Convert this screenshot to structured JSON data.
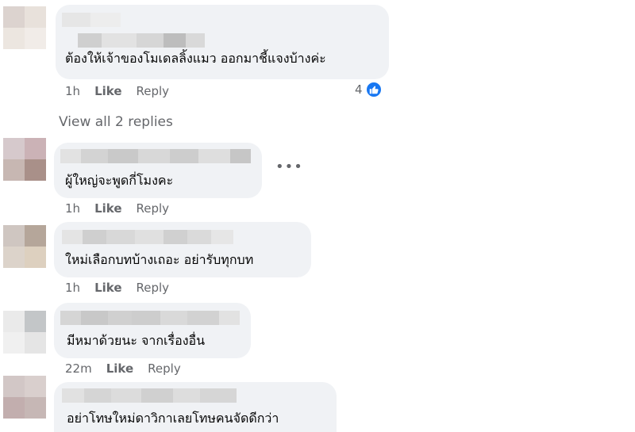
{
  "colors": {
    "bubble": "#f0f2f5",
    "meta": "#65676b",
    "like_badge": "#1877f2"
  },
  "comments": [
    {
      "text": "ต้องให้เจ้าของโมเดลลิ้งแมว ออกมาชี้แจงบ้างค่ะ",
      "time": "1h",
      "like": "Like",
      "reply": "Reply",
      "reaction_count": "4"
    },
    {
      "text": "ผู้ใหญ่จะพูดกี่โมงคะ",
      "time": "1h",
      "like": "Like",
      "reply": "Reply"
    },
    {
      "text": "ใหม่เลือกบทบ้างเถอะ อย่ารับทุกบท",
      "time": "1h",
      "like": "Like",
      "reply": "Reply"
    },
    {
      "text": "มีหมาด้วยนะ จากเรื่องอื่น",
      "time": "22m",
      "like": "Like",
      "reply": "Reply"
    },
    {
      "text": "อย่าโทษใหม่ดาวิกาเลยโทษคนจัดดีกว่า",
      "time": "",
      "like": "",
      "reply": ""
    }
  ],
  "view_replies": "View all 2 replies",
  "more_icon": "more-options-icon",
  "reaction_icon": "like-reaction-icon"
}
